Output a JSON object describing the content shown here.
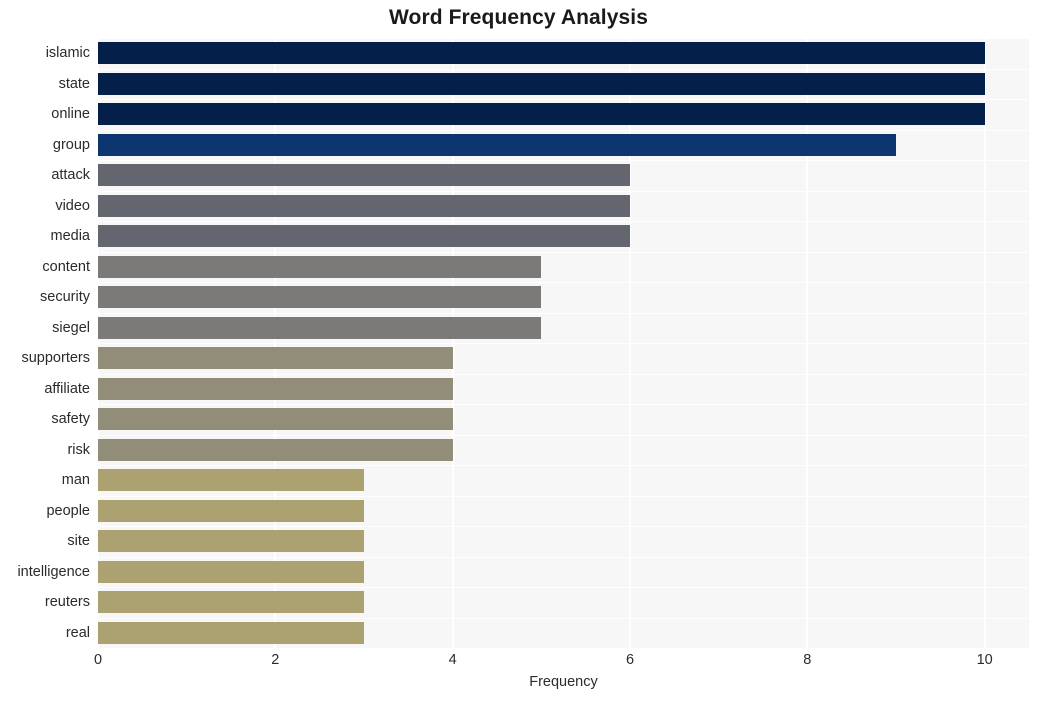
{
  "chart_data": {
    "type": "bar",
    "orientation": "horizontal",
    "title": "Word Frequency Analysis",
    "xlabel": "Frequency",
    "ylabel": "",
    "xlim": [
      0,
      10.5
    ],
    "xticks": [
      "0",
      "2",
      "4",
      "6",
      "8",
      "10"
    ],
    "xtick_values": [
      0,
      2,
      4,
      6,
      8,
      10
    ],
    "grid": true,
    "legend": "none",
    "categories": [
      "islamic",
      "state",
      "online",
      "group",
      "attack",
      "video",
      "media",
      "content",
      "security",
      "siegel",
      "supporters",
      "affiliate",
      "safety",
      "risk",
      "man",
      "people",
      "site",
      "intelligence",
      "reuters",
      "real"
    ],
    "values": [
      10,
      10,
      10,
      9,
      6,
      6,
      6,
      5,
      5,
      5,
      4,
      4,
      4,
      4,
      3,
      3,
      3,
      3,
      3,
      3
    ],
    "bar_colors": [
      "#04204a",
      "#04204a",
      "#04204a",
      "#0d3570",
      "#63666f",
      "#63666f",
      "#63666f",
      "#7b7a78",
      "#7b7a78",
      "#7b7a78",
      "#918d78",
      "#918d78",
      "#918d78",
      "#918d78",
      "#aca271",
      "#aca271",
      "#aca271",
      "#aca271",
      "#aca271",
      "#aca271"
    ],
    "plot_background": "#f7f7f7",
    "gridline_color": "#ffffff",
    "figure_background": "#ffffff"
  }
}
